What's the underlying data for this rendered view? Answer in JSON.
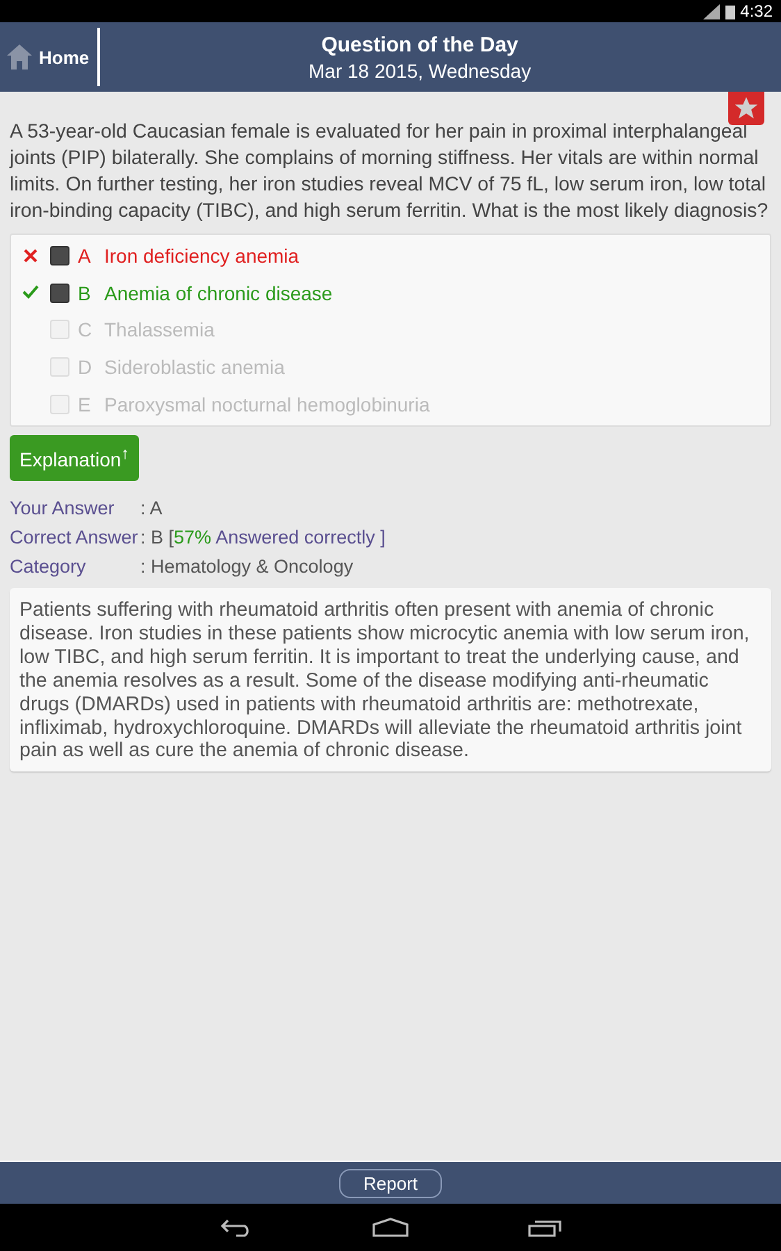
{
  "status_bar": {
    "time": "4:32"
  },
  "header": {
    "home": "Home",
    "title": "Question of the Day",
    "date": "Mar 18 2015, Wednesday"
  },
  "bookmark": {
    "starred": false
  },
  "question": "A 53-year-old Caucasian female is evaluated for her pain in proximal interphalangeal joints (PIP) bilaterally. She complains of morning stiffness. Her vitals are within normal limits. On further testing, her iron studies reveal MCV of 75 fL, low serum iron, low total iron-binding capacity (TIBC), and high serum ferritin. What is the most likely diagnosis?",
  "options": [
    {
      "letter": "A",
      "text": "Iron deficiency anemia",
      "checked": true,
      "kind": "wrong"
    },
    {
      "letter": "B",
      "text": "Anemia of chronic disease",
      "checked": true,
      "kind": "correct"
    },
    {
      "letter": "C",
      "text": "Thalassemia",
      "checked": false,
      "kind": "plain"
    },
    {
      "letter": "D",
      "text": "Sideroblastic anemia",
      "checked": false,
      "kind": "plain"
    },
    {
      "letter": "E",
      "text": "Paroxysmal nocturnal hemoglobinuria",
      "checked": false,
      "kind": "plain"
    }
  ],
  "explanation_button": {
    "label": "Explanation",
    "arrow": "↑"
  },
  "your_answer": {
    "label": "Your Answer",
    "value": ": A"
  },
  "correct_answer": {
    "label": "Correct Answer",
    "value": ": B [",
    "percent": "57%",
    "suffix": "Answered correctly ]"
  },
  "category": {
    "label": "Category",
    "value": ": Hematology & Oncology"
  },
  "explanation": "Patients suffering with rheumatoid arthritis often present with anemia of chronic disease. Iron studies in these patients show microcytic anemia with low serum iron, low TIBC, and high serum ferritin. It is important to treat the underlying cause, and the anemia resolves as a result. Some of the disease modifying anti-rheumatic drugs (DMARDs) used in patients with rheumatoid arthritis are: methotrexate, infliximab, hydroxychloroquine. DMARDs will alleviate the rheumatoid arthritis joint pain as well as cure the anemia of chronic disease.",
  "report_button": "Report"
}
